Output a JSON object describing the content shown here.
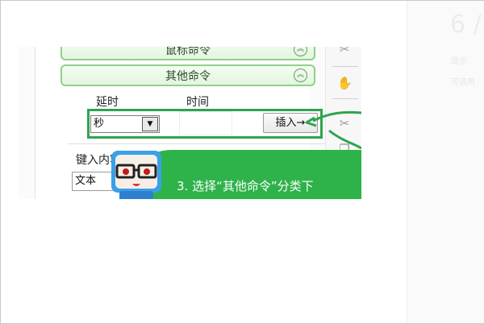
{
  "right_pane": {
    "big_text": "6 /",
    "line1": "提示",
    "line2": "可选用"
  },
  "panel": {
    "mouse_commands_label": "鼠标命令",
    "other_commands_label": "其他命令",
    "delay_label": "延时",
    "time_label": "时间",
    "unit_select": {
      "value": "秒"
    },
    "time_input": {
      "value": ""
    },
    "insert_button": "插入→",
    "key_input_label": "键入内容",
    "key_input_value": "文本"
  },
  "toolbar": {
    "icons": [
      "scissors-icon",
      "hand-icon",
      "clip-icon",
      "copy-icon"
    ]
  },
  "tutorial": {
    "banner_text": "3. 选择“其他命令”分类下",
    "accent_color": "#2eb24a"
  }
}
